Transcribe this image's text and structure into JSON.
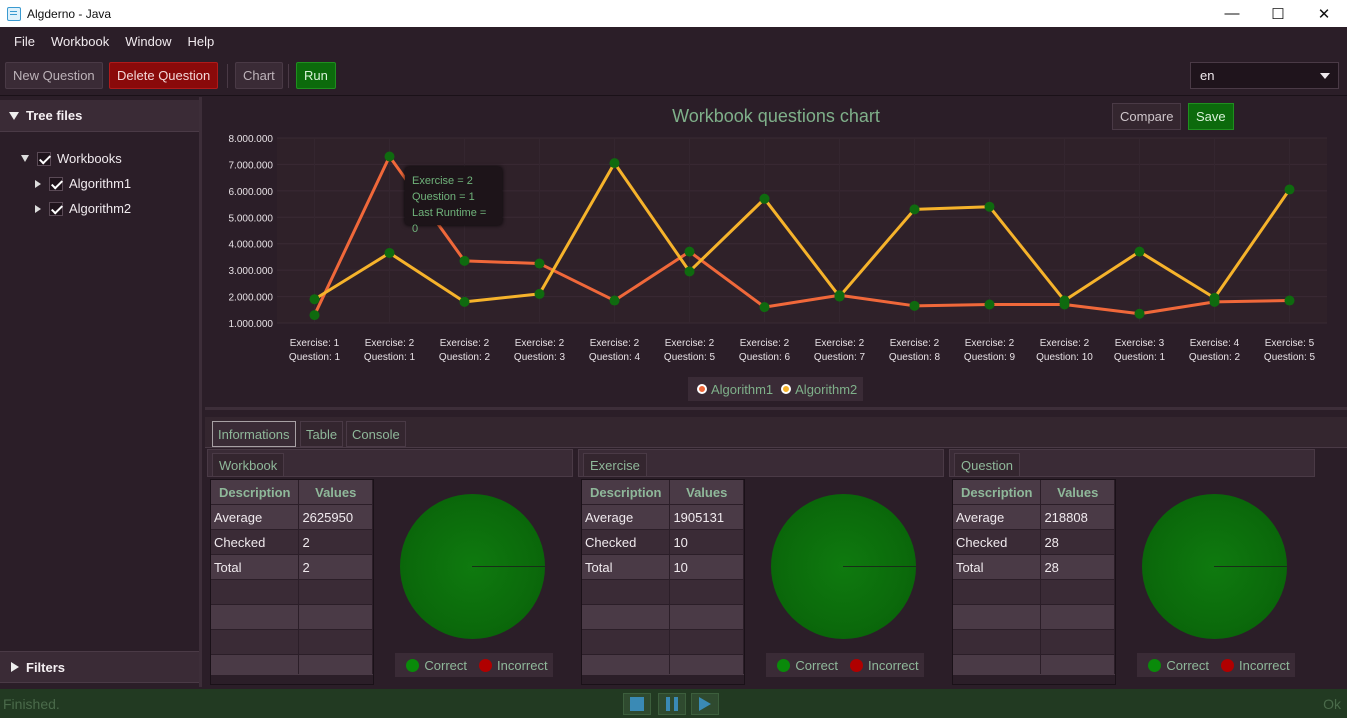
{
  "window": {
    "title": "Algderno - Java",
    "min": "—",
    "max": "☐",
    "close": "✕"
  },
  "menu": {
    "file": "File",
    "workbook": "Workbook",
    "window": "Window",
    "help": "Help"
  },
  "toolbar": {
    "new_question": "New Question",
    "delete_question": "Delete Question",
    "chart": "Chart",
    "run": "Run",
    "language": "en"
  },
  "tree": {
    "header": "Tree files",
    "root": "Workbooks",
    "items": [
      "Algorithm1",
      "Algorithm2"
    ],
    "filters": "Filters"
  },
  "chart_header": {
    "title": "Workbook questions chart",
    "compare": "Compare",
    "save": "Save"
  },
  "tooltip": {
    "line1": "Exercise = 2",
    "line2": "Question = 1",
    "line3": "Last Runtime = 0"
  },
  "chart_data": {
    "type": "line",
    "title": "Workbook questions chart",
    "categories": [
      "Exercise: 1 Question: 1",
      "Exercise: 2 Question: 1",
      "Exercise: 2 Question: 2",
      "Exercise: 2 Question: 3",
      "Exercise: 2 Question: 4",
      "Exercise: 2 Question: 5",
      "Exercise: 2 Question: 6",
      "Exercise: 2 Question: 7",
      "Exercise: 2 Question: 8",
      "Exercise: 2 Question: 9",
      "Exercise: 2 Question: 10",
      "Exercise: 3 Question: 1",
      "Exercise: 4 Question: 2",
      "Exercise: 5 Question: 5"
    ],
    "yticks": [
      "1.000.000",
      "2.000.000",
      "3.000.000",
      "4.000.000",
      "5.000.000",
      "6.000.000",
      "7.000.000",
      "8.000.000"
    ],
    "ylim": [
      1000000,
      8000000
    ],
    "series": [
      {
        "name": "Algorithm1",
        "color": "#f0683a",
        "values": [
          1300000,
          7300000,
          3350000,
          3250000,
          1850000,
          3700000,
          1600000,
          2050000,
          1650000,
          1700000,
          1700000,
          1350000,
          1800000,
          1850000
        ]
      },
      {
        "name": "Algorithm2",
        "color": "#f6b32b",
        "values": [
          1900000,
          3650000,
          1800000,
          2100000,
          7050000,
          2950000,
          5700000,
          2000000,
          5300000,
          5400000,
          1850000,
          3700000,
          1950000,
          6050000
        ]
      }
    ],
    "legend_position": "bottom"
  },
  "tabs": [
    "Informations",
    "Table",
    "Console"
  ],
  "table_headers": {
    "description": "Description",
    "values": "Values"
  },
  "pie_legend": {
    "correct": "Correct",
    "incorrect": "Incorrect"
  },
  "sections": [
    {
      "title": "Workbook",
      "rows": [
        [
          "Average",
          "2625950"
        ],
        [
          "Checked",
          "2"
        ],
        [
          "Total",
          "2"
        ]
      ],
      "correct_fraction": 1
    },
    {
      "title": "Exercise",
      "rows": [
        [
          "Average",
          "1905131"
        ],
        [
          "Checked",
          "10"
        ],
        [
          "Total",
          "10"
        ]
      ],
      "correct_fraction": 1
    },
    {
      "title": "Question",
      "rows": [
        [
          "Average",
          "218808"
        ],
        [
          "Checked",
          "28"
        ],
        [
          "Total",
          "28"
        ]
      ],
      "correct_fraction": 1
    }
  ],
  "status": {
    "left": "Finished.",
    "right": "Ok"
  },
  "colors": {
    "correct": "#0a8a0a",
    "incorrect": "#b00000",
    "point": "#0f6a0f"
  }
}
